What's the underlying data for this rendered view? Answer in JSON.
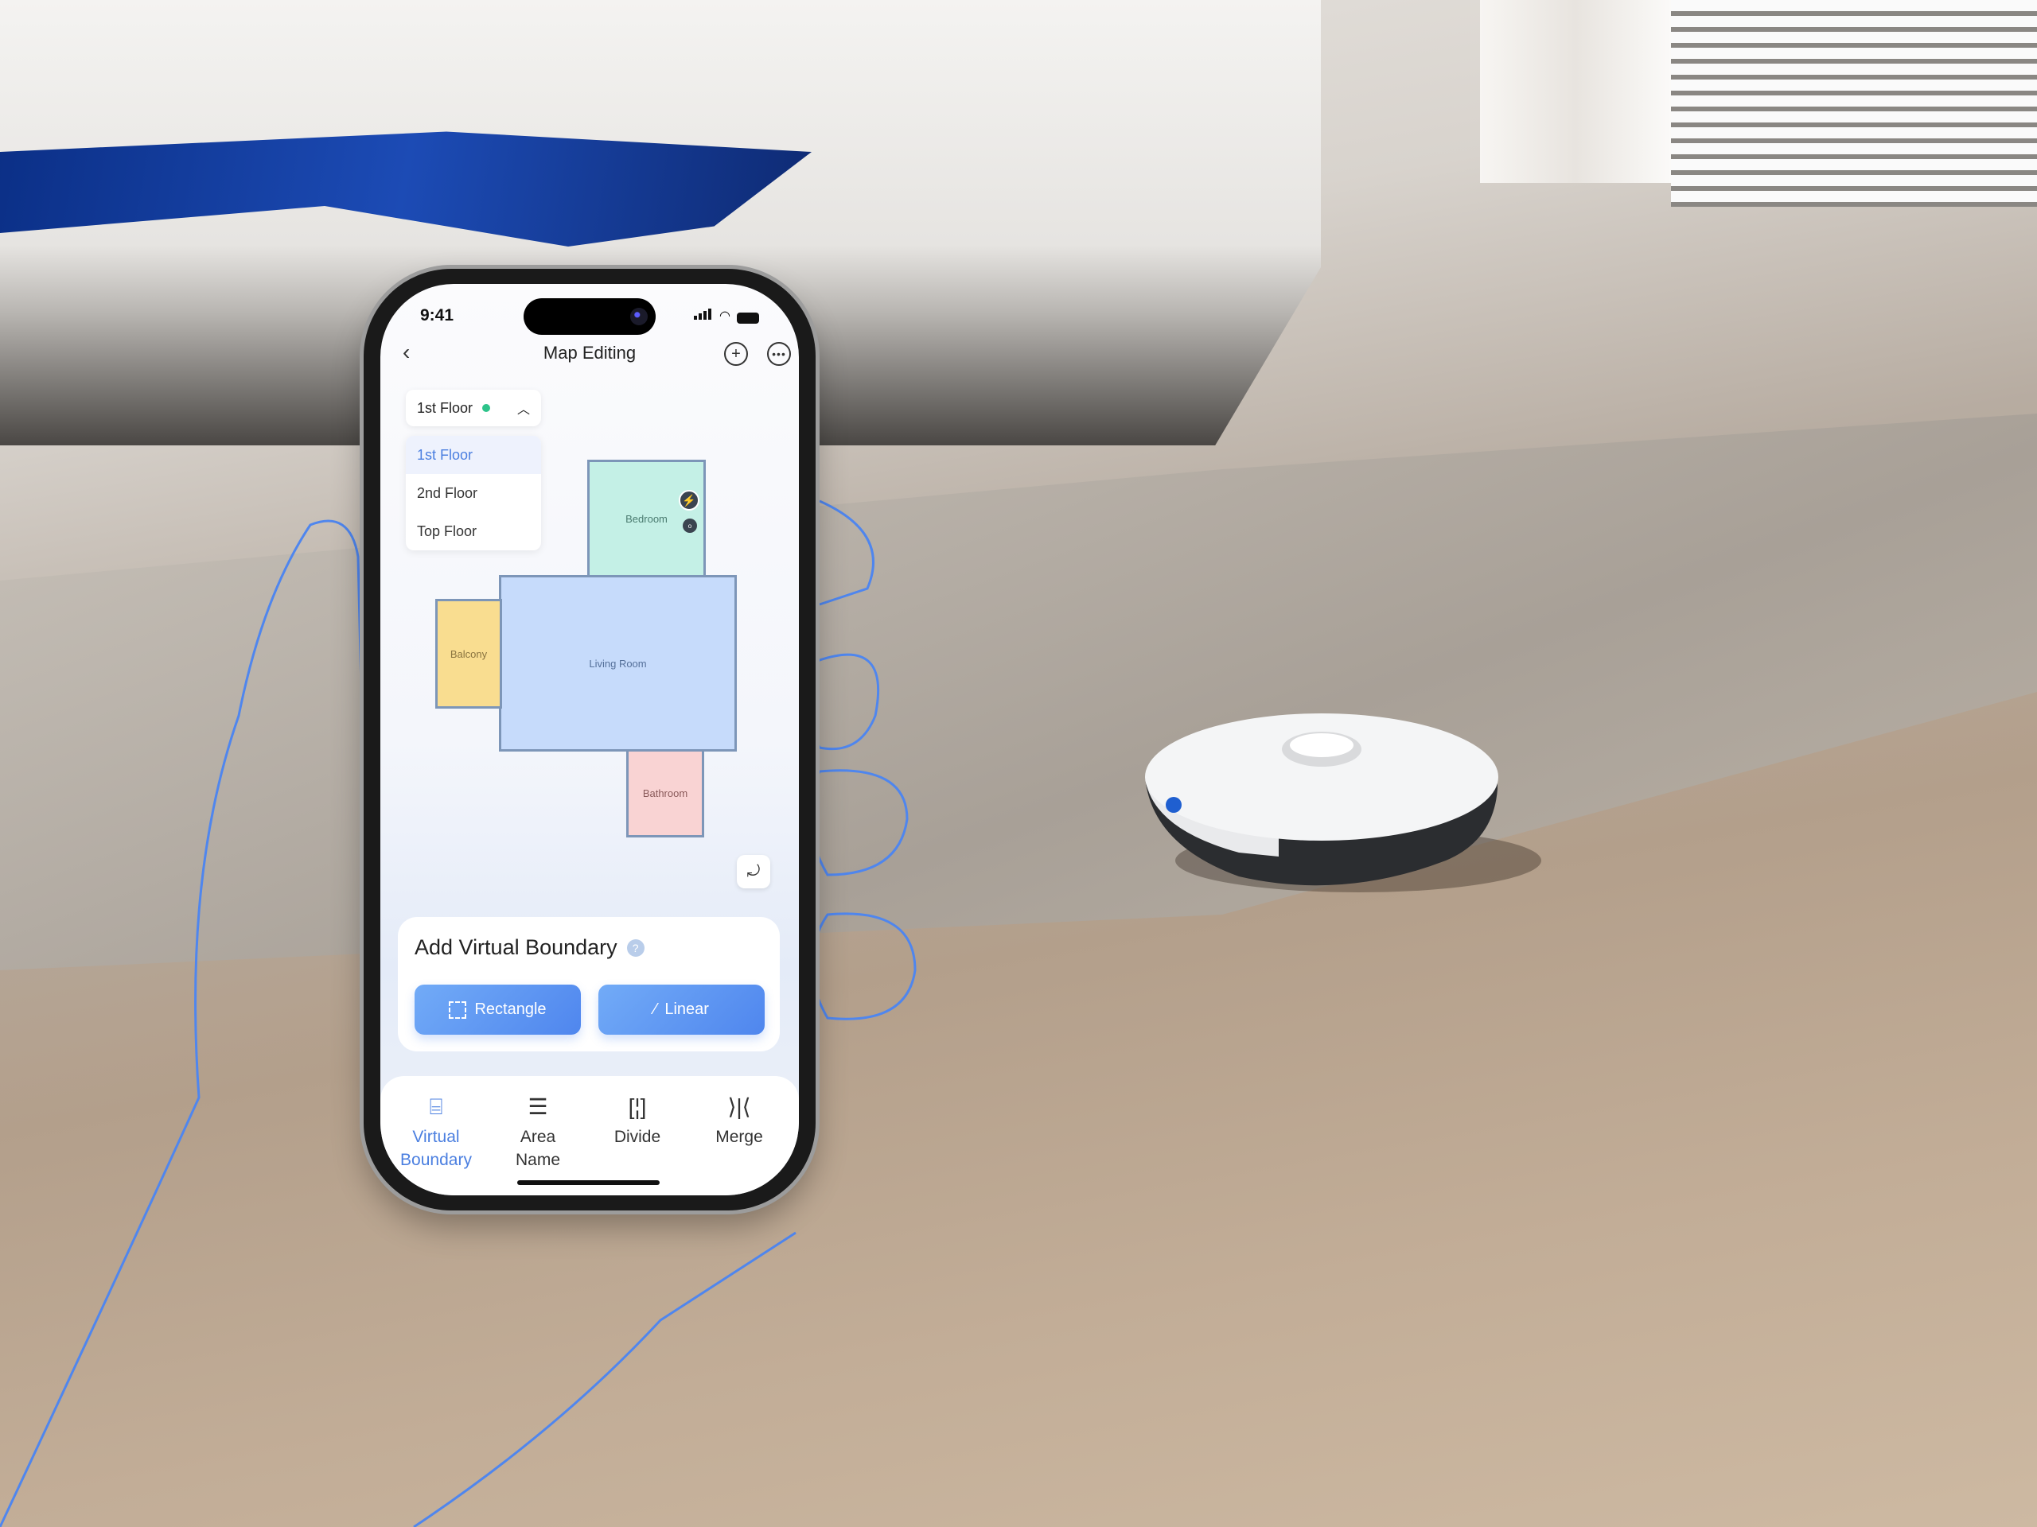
{
  "status_bar": {
    "time": "9:41"
  },
  "header": {
    "title": "Map Editing",
    "back_icon": "chevron-left-icon",
    "add_icon": "plus-circle-icon",
    "more_icon": "more-circle-icon"
  },
  "floor_selector": {
    "selected": "1st Floor",
    "status_color": "#2dc38a",
    "options": [
      "1st Floor",
      "2nd Floor",
      "Top Floor"
    ]
  },
  "map": {
    "rooms": {
      "bedroom": "Bedroom",
      "living_room": "Living Room",
      "balcony": "Balcony",
      "bathroom": "Bathroom"
    },
    "dock_icon": "lightning-icon",
    "robot_icon": "robot-icon",
    "rotate_icon": "rotate-icon"
  },
  "boundary_card": {
    "title": "Add Virtual Boundary",
    "help_icon": "?",
    "rectangle_label": "Rectangle",
    "linear_label": "Linear"
  },
  "bottom_nav": {
    "items": [
      {
        "label": "Virtual Boundary",
        "icon": "boundary-icon",
        "active": true
      },
      {
        "label": "Area Name",
        "icon": "list-icon"
      },
      {
        "label": "Divide",
        "icon": "divide-icon"
      },
      {
        "label": "Merge",
        "icon": "merge-icon"
      }
    ]
  },
  "colors": {
    "accent": "#4b7fe0"
  }
}
